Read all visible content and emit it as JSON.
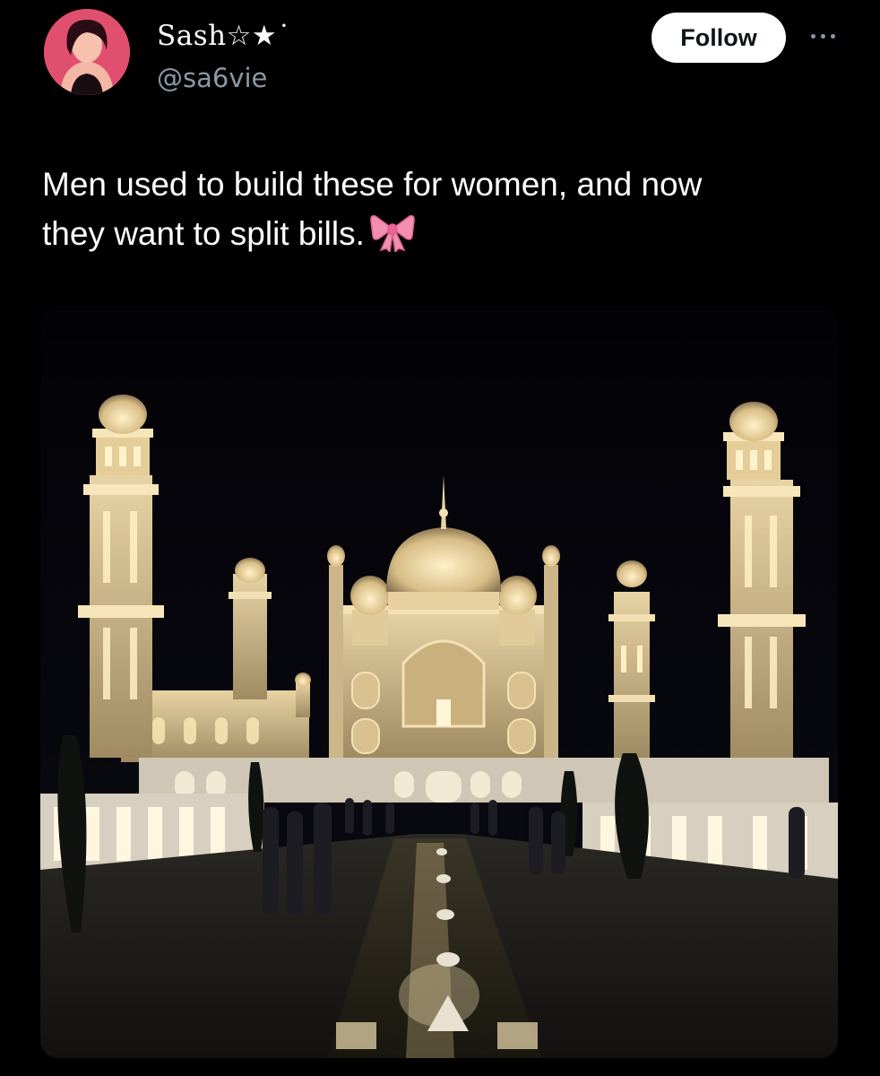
{
  "author": {
    "display_name": "Sash☆★˙",
    "handle": "@sa6vie",
    "avatar_icon": "user-avatar-photo"
  },
  "actions": {
    "follow_label": "Follow",
    "more_icon": "more-horizontal-icon"
  },
  "tweet": {
    "text_line1": "Men used to build these for women, and now",
    "text_line2": "they want to split bills.",
    "emoji_icon": "pink-ribbon-bow-icon"
  },
  "media": {
    "kind": "photo",
    "subject_icon": "illuminated-mausoleum-night-photo"
  },
  "colors": {
    "background": "#000000",
    "text_primary": "#ffffff",
    "text_secondary": "#8b98a5",
    "follow_bg": "#ffffff",
    "follow_text": "#0f1419",
    "bow_pink": "#f48fb1"
  }
}
